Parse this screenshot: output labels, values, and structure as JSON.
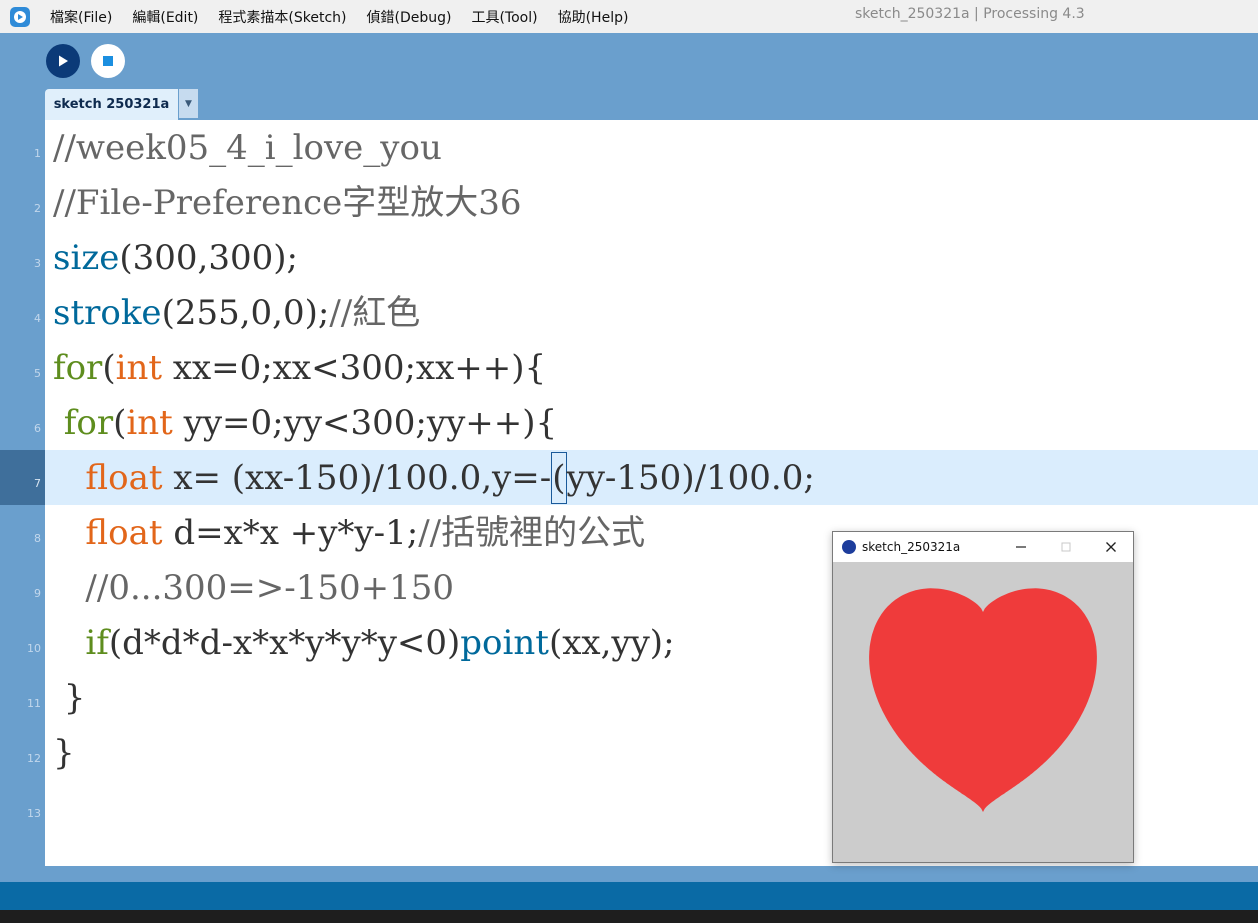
{
  "menubar": {
    "items": [
      "檔案(File)",
      "編輯(Edit)",
      "程式素描本(Sketch)",
      "偵錯(Debug)",
      "工具(Tool)",
      "協助(Help)"
    ],
    "window_title": "sketch_250321a | Processing 4.3"
  },
  "toolbar": {
    "run_icon": "play-icon",
    "stop_icon": "stop-icon"
  },
  "tab": {
    "label": "sketch 250321a",
    "menu_glyph": "▼"
  },
  "editor": {
    "current_line": 7,
    "lines": [
      {
        "n": "1",
        "tokens": [
          {
            "t": "//week05_4_i_love_you",
            "c": "comment"
          }
        ]
      },
      {
        "n": "2",
        "tokens": [
          {
            "t": "//File-Preference字型放大36",
            "c": "comment"
          }
        ]
      },
      {
        "n": "3",
        "tokens": [
          {
            "t": "size",
            "c": "func"
          },
          {
            "t": "(300,300);",
            "c": "plain"
          }
        ]
      },
      {
        "n": "4",
        "tokens": [
          {
            "t": "stroke",
            "c": "func"
          },
          {
            "t": "(255,0,0);",
            "c": "plain"
          },
          {
            "t": "//紅色",
            "c": "comment"
          }
        ]
      },
      {
        "n": "5",
        "tokens": [
          {
            "t": "for",
            "c": "kw"
          },
          {
            "t": "(",
            "c": "plain"
          },
          {
            "t": "int",
            "c": "type"
          },
          {
            "t": " xx=0;xx<300;xx++){",
            "c": "plain"
          }
        ]
      },
      {
        "n": "6",
        "tokens": [
          {
            "t": " for",
            "c": "kw"
          },
          {
            "t": "(",
            "c": "plain"
          },
          {
            "t": "int",
            "c": "type"
          },
          {
            "t": " yy=0;yy<300;yy++){",
            "c": "plain"
          }
        ]
      },
      {
        "n": "7",
        "tokens": [
          {
            "t": "   float",
            "c": "type"
          },
          {
            "t": " x= (xx-150)/100.0,y=-",
            "c": "plain"
          },
          {
            "t": "(",
            "c": "cursor"
          },
          {
            "t": "yy-150)/100.0;",
            "c": "plain"
          }
        ]
      },
      {
        "n": "8",
        "tokens": [
          {
            "t": "   float",
            "c": "type"
          },
          {
            "t": " d=x*x +y*y-1;",
            "c": "plain"
          },
          {
            "t": "//括號裡的公式",
            "c": "comment"
          }
        ]
      },
      {
        "n": "9",
        "tokens": [
          {
            "t": "   //0...300=>-150+150",
            "c": "comment"
          }
        ]
      },
      {
        "n": "10",
        "tokens": [
          {
            "t": "   if",
            "c": "kw"
          },
          {
            "t": "(d*d*d-x*x*y*y*y<0)",
            "c": "plain"
          },
          {
            "t": "point",
            "c": "func"
          },
          {
            "t": "(xx,yy);",
            "c": "plain"
          }
        ]
      },
      {
        "n": "11",
        "tokens": [
          {
            "t": " }",
            "c": "plain"
          }
        ]
      },
      {
        "n": "12",
        "tokens": [
          {
            "t": "}",
            "c": "plain"
          }
        ]
      },
      {
        "n": "13",
        "tokens": []
      }
    ]
  },
  "sketch_window": {
    "title": "sketch_250321a",
    "background": "#cccccc",
    "heart_color": "#ef3b3b"
  },
  "colors": {
    "toolbar_bg": "#6a9fcd",
    "run_button": "#0b3a78",
    "line_highlight": "#daedfd",
    "status_bar": "#0a6aa5"
  }
}
